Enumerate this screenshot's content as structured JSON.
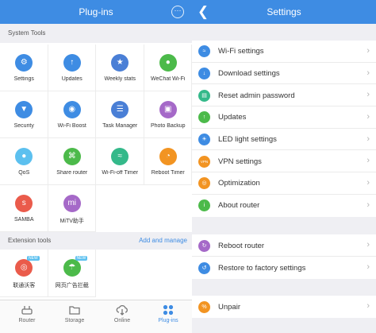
{
  "left": {
    "title": "Plug-ins",
    "more_label": "···",
    "system_tools_label": "System Tools",
    "tools": [
      {
        "label": "Settings",
        "icon": "gear-icon",
        "color": "#3e8ce3",
        "glyph": "⚙"
      },
      {
        "label": "Updates",
        "icon": "upload-arrow-icon",
        "color": "#3e8ce3",
        "glyph": "↑"
      },
      {
        "label": "Weekly stats",
        "icon": "star-badge-icon",
        "color": "#4a7fd6",
        "glyph": "★"
      },
      {
        "label": "WeChat Wi-Fi",
        "icon": "wechat-icon",
        "color": "#4cba4a",
        "glyph": "●"
      },
      {
        "label": "Security",
        "icon": "shield-icon",
        "color": "#3e8ce3",
        "glyph": "▼"
      },
      {
        "label": "Wi-Fi Boost",
        "icon": "boost-icon",
        "color": "#3e8ce3",
        "glyph": "◉"
      },
      {
        "label": "Task Manager",
        "icon": "task-manager-icon",
        "color": "#4a7fd6",
        "glyph": "☰"
      },
      {
        "label": "Photo Backup",
        "icon": "photo-icon",
        "color": "#a569c8",
        "glyph": "▣"
      },
      {
        "label": "QoS",
        "icon": "qos-icon",
        "color": "#5cc0ef",
        "glyph": "●"
      },
      {
        "label": "Share router",
        "icon": "share-icon",
        "color": "#4cba4a",
        "glyph": "⌘"
      },
      {
        "label": "Wi-Fi-off Timer",
        "icon": "wifi-timer-icon",
        "color": "#34b98a",
        "glyph": "≈"
      },
      {
        "label": "Reboot Timer",
        "icon": "reboot-timer-icon",
        "color": "#f29422",
        "glyph": "◔"
      },
      {
        "label": "SAMBA",
        "icon": "samba-icon",
        "color": "#ea5b4b",
        "glyph": "s"
      },
      {
        "label": "MiTV助手",
        "icon": "mitv-icon",
        "color": "#a569c8",
        "glyph": "mi"
      }
    ],
    "extension_tools_label": "Extension tools",
    "add_manage_label": "Add and manage",
    "extensions": [
      {
        "label": "联通沃客",
        "icon": "unicom-icon",
        "color": "#ea5b4b",
        "glyph": "◎",
        "badge": "NEW"
      },
      {
        "label": "网页广告拦截",
        "icon": "umbrella-icon",
        "color": "#4cba4a",
        "glyph": "☂",
        "badge": "NEW"
      }
    ],
    "tabs": [
      {
        "label": "Router",
        "icon": "router-icon"
      },
      {
        "label": "Storage",
        "icon": "folder-icon"
      },
      {
        "label": "Online",
        "icon": "cloud-download-icon"
      },
      {
        "label": "Plug-ins",
        "icon": "plugins-grid-icon"
      }
    ],
    "accent_color": "#3e8ce3"
  },
  "right": {
    "title": "Settings",
    "back_label": "❮",
    "group1": [
      {
        "label": "Wi-Fi settings",
        "icon": "wifi-icon",
        "color": "#3e8ce3",
        "glyph": "≈"
      },
      {
        "label": "Download settings",
        "icon": "download-icon",
        "color": "#3e8ce3",
        "glyph": "↓"
      },
      {
        "label": "Reset admin password",
        "icon": "lock-icon",
        "color": "#34b98a",
        "glyph": "▤"
      },
      {
        "label": "Updates",
        "icon": "update-icon",
        "color": "#4cba4a",
        "glyph": "↑"
      },
      {
        "label": "LED light settings",
        "icon": "led-icon",
        "color": "#3e8ce3",
        "glyph": "☀"
      },
      {
        "label": "VPN settings",
        "icon": "vpn-icon",
        "color": "#f29422",
        "glyph": "VPN"
      },
      {
        "label": "Optimization",
        "icon": "optimization-icon",
        "color": "#f29422",
        "glyph": "◎"
      },
      {
        "label": "About router",
        "icon": "info-icon",
        "color": "#4cba4a",
        "glyph": "i"
      }
    ],
    "group2": [
      {
        "label": "Reboot router",
        "icon": "reboot-icon",
        "color": "#a569c8",
        "glyph": "↻"
      },
      {
        "label": "Restore to factory settings",
        "icon": "restore-icon",
        "color": "#3e8ce3",
        "glyph": "↺"
      }
    ],
    "group3": [
      {
        "label": "Unpair",
        "icon": "unpair-icon",
        "color": "#f29422",
        "glyph": "%"
      }
    ],
    "chevron": "›"
  }
}
